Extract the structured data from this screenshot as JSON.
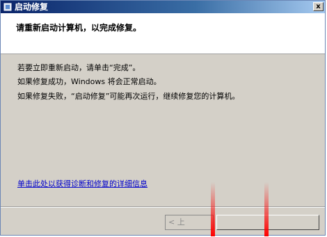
{
  "window": {
    "title": "启动修复",
    "close_glyph": "x"
  },
  "header": {
    "text": "请重新启动计算机，以完成修复。"
  },
  "body": {
    "line1": "若要立即重新启动，请单击“完成”。",
    "line2": "如果修复成功，Windows 将会正常启动。",
    "line3": "如果修复失败，“启动修复”可能再次运行，继续修复您的计算机。"
  },
  "link": {
    "text": "单击此处以获得诊断和修复的详细信息"
  },
  "buttons": {
    "back_label": "< 上",
    "finish_label": ""
  },
  "colors": {
    "titlebar_start": "#0a246a",
    "titlebar_end": "#a6caf0",
    "link": "#0000cc",
    "annotation": "#ff0000"
  }
}
